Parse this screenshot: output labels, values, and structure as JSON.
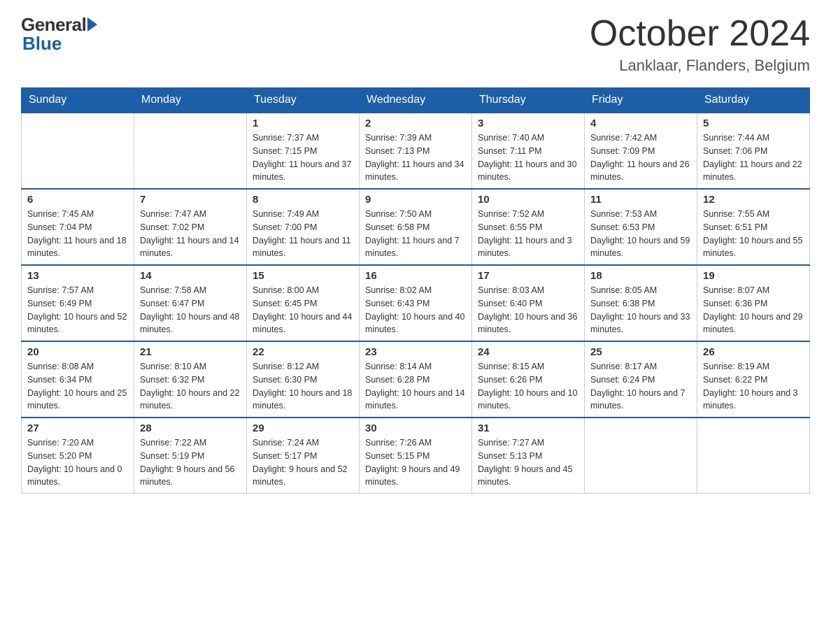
{
  "logo": {
    "general": "General",
    "blue": "Blue"
  },
  "header": {
    "month": "October 2024",
    "location": "Lanklaar, Flanders, Belgium"
  },
  "weekdays": [
    "Sunday",
    "Monday",
    "Tuesday",
    "Wednesday",
    "Thursday",
    "Friday",
    "Saturday"
  ],
  "weeks": [
    [
      {
        "day": "",
        "sunrise": "",
        "sunset": "",
        "daylight": ""
      },
      {
        "day": "",
        "sunrise": "",
        "sunset": "",
        "daylight": ""
      },
      {
        "day": "1",
        "sunrise": "Sunrise: 7:37 AM",
        "sunset": "Sunset: 7:15 PM",
        "daylight": "Daylight: 11 hours and 37 minutes."
      },
      {
        "day": "2",
        "sunrise": "Sunrise: 7:39 AM",
        "sunset": "Sunset: 7:13 PM",
        "daylight": "Daylight: 11 hours and 34 minutes."
      },
      {
        "day": "3",
        "sunrise": "Sunrise: 7:40 AM",
        "sunset": "Sunset: 7:11 PM",
        "daylight": "Daylight: 11 hours and 30 minutes."
      },
      {
        "day": "4",
        "sunrise": "Sunrise: 7:42 AM",
        "sunset": "Sunset: 7:09 PM",
        "daylight": "Daylight: 11 hours and 26 minutes."
      },
      {
        "day": "5",
        "sunrise": "Sunrise: 7:44 AM",
        "sunset": "Sunset: 7:06 PM",
        "daylight": "Daylight: 11 hours and 22 minutes."
      }
    ],
    [
      {
        "day": "6",
        "sunrise": "Sunrise: 7:45 AM",
        "sunset": "Sunset: 7:04 PM",
        "daylight": "Daylight: 11 hours and 18 minutes."
      },
      {
        "day": "7",
        "sunrise": "Sunrise: 7:47 AM",
        "sunset": "Sunset: 7:02 PM",
        "daylight": "Daylight: 11 hours and 14 minutes."
      },
      {
        "day": "8",
        "sunrise": "Sunrise: 7:49 AM",
        "sunset": "Sunset: 7:00 PM",
        "daylight": "Daylight: 11 hours and 11 minutes."
      },
      {
        "day": "9",
        "sunrise": "Sunrise: 7:50 AM",
        "sunset": "Sunset: 6:58 PM",
        "daylight": "Daylight: 11 hours and 7 minutes."
      },
      {
        "day": "10",
        "sunrise": "Sunrise: 7:52 AM",
        "sunset": "Sunset: 6:55 PM",
        "daylight": "Daylight: 11 hours and 3 minutes."
      },
      {
        "day": "11",
        "sunrise": "Sunrise: 7:53 AM",
        "sunset": "Sunset: 6:53 PM",
        "daylight": "Daylight: 10 hours and 59 minutes."
      },
      {
        "day": "12",
        "sunrise": "Sunrise: 7:55 AM",
        "sunset": "Sunset: 6:51 PM",
        "daylight": "Daylight: 10 hours and 55 minutes."
      }
    ],
    [
      {
        "day": "13",
        "sunrise": "Sunrise: 7:57 AM",
        "sunset": "Sunset: 6:49 PM",
        "daylight": "Daylight: 10 hours and 52 minutes."
      },
      {
        "day": "14",
        "sunrise": "Sunrise: 7:58 AM",
        "sunset": "Sunset: 6:47 PM",
        "daylight": "Daylight: 10 hours and 48 minutes."
      },
      {
        "day": "15",
        "sunrise": "Sunrise: 8:00 AM",
        "sunset": "Sunset: 6:45 PM",
        "daylight": "Daylight: 10 hours and 44 minutes."
      },
      {
        "day": "16",
        "sunrise": "Sunrise: 8:02 AM",
        "sunset": "Sunset: 6:43 PM",
        "daylight": "Daylight: 10 hours and 40 minutes."
      },
      {
        "day": "17",
        "sunrise": "Sunrise: 8:03 AM",
        "sunset": "Sunset: 6:40 PM",
        "daylight": "Daylight: 10 hours and 36 minutes."
      },
      {
        "day": "18",
        "sunrise": "Sunrise: 8:05 AM",
        "sunset": "Sunset: 6:38 PM",
        "daylight": "Daylight: 10 hours and 33 minutes."
      },
      {
        "day": "19",
        "sunrise": "Sunrise: 8:07 AM",
        "sunset": "Sunset: 6:36 PM",
        "daylight": "Daylight: 10 hours and 29 minutes."
      }
    ],
    [
      {
        "day": "20",
        "sunrise": "Sunrise: 8:08 AM",
        "sunset": "Sunset: 6:34 PM",
        "daylight": "Daylight: 10 hours and 25 minutes."
      },
      {
        "day": "21",
        "sunrise": "Sunrise: 8:10 AM",
        "sunset": "Sunset: 6:32 PM",
        "daylight": "Daylight: 10 hours and 22 minutes."
      },
      {
        "day": "22",
        "sunrise": "Sunrise: 8:12 AM",
        "sunset": "Sunset: 6:30 PM",
        "daylight": "Daylight: 10 hours and 18 minutes."
      },
      {
        "day": "23",
        "sunrise": "Sunrise: 8:14 AM",
        "sunset": "Sunset: 6:28 PM",
        "daylight": "Daylight: 10 hours and 14 minutes."
      },
      {
        "day": "24",
        "sunrise": "Sunrise: 8:15 AM",
        "sunset": "Sunset: 6:26 PM",
        "daylight": "Daylight: 10 hours and 10 minutes."
      },
      {
        "day": "25",
        "sunrise": "Sunrise: 8:17 AM",
        "sunset": "Sunset: 6:24 PM",
        "daylight": "Daylight: 10 hours and 7 minutes."
      },
      {
        "day": "26",
        "sunrise": "Sunrise: 8:19 AM",
        "sunset": "Sunset: 6:22 PM",
        "daylight": "Daylight: 10 hours and 3 minutes."
      }
    ],
    [
      {
        "day": "27",
        "sunrise": "Sunrise: 7:20 AM",
        "sunset": "Sunset: 5:20 PM",
        "daylight": "Daylight: 10 hours and 0 minutes."
      },
      {
        "day": "28",
        "sunrise": "Sunrise: 7:22 AM",
        "sunset": "Sunset: 5:19 PM",
        "daylight": "Daylight: 9 hours and 56 minutes."
      },
      {
        "day": "29",
        "sunrise": "Sunrise: 7:24 AM",
        "sunset": "Sunset: 5:17 PM",
        "daylight": "Daylight: 9 hours and 52 minutes."
      },
      {
        "day": "30",
        "sunrise": "Sunrise: 7:26 AM",
        "sunset": "Sunset: 5:15 PM",
        "daylight": "Daylight: 9 hours and 49 minutes."
      },
      {
        "day": "31",
        "sunrise": "Sunrise: 7:27 AM",
        "sunset": "Sunset: 5:13 PM",
        "daylight": "Daylight: 9 hours and 45 minutes."
      },
      {
        "day": "",
        "sunrise": "",
        "sunset": "",
        "daylight": ""
      },
      {
        "day": "",
        "sunrise": "",
        "sunset": "",
        "daylight": ""
      }
    ]
  ]
}
